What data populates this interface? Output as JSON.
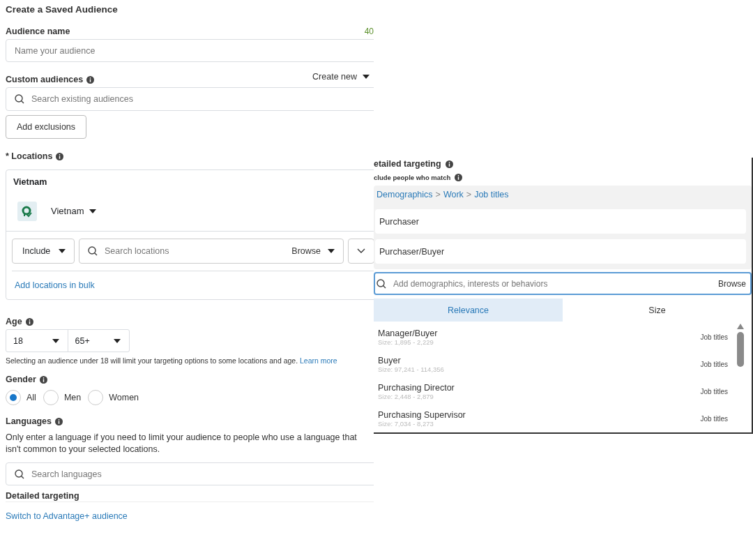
{
  "title": "Create a Saved Audience",
  "audience_name": {
    "label": "Audience name",
    "counter": "40",
    "placeholder": "Name your audience"
  },
  "custom_audiences": {
    "label": "Custom audiences",
    "create_new": "Create new",
    "placeholder": "Search existing audiences",
    "exclusions_button": "Add exclusions"
  },
  "locations": {
    "label": "Locations",
    "required_mark": "*",
    "group_title": "Vietnam",
    "country": "Vietnam",
    "include": "Include",
    "placeholder": "Search locations",
    "browse": "Browse",
    "bulk_link": "Add locations in bulk"
  },
  "age": {
    "label": "Age",
    "min": "18",
    "max": "65+",
    "note": "Selecting an audience under 18 will limit your targeting options to some locations and age.",
    "note_link": "Learn more"
  },
  "gender": {
    "label": "Gender",
    "options": [
      {
        "label": "All",
        "selected": true
      },
      {
        "label": "Men",
        "selected": false
      },
      {
        "label": "Women",
        "selected": false
      }
    ]
  },
  "languages": {
    "label": "Languages",
    "description": "Only enter a language if you need to limit your audience to people who use a language that isn't common to your selected locations.",
    "placeholder": "Search languages"
  },
  "detailed_targeting_cut": "Detailed targeting",
  "switch_link": "Switch to Advantage+ audience",
  "detailed_panel": {
    "heading": "etailed targeting",
    "subheading": "clude people who match",
    "breadcrumb": [
      "Demographics",
      "Work",
      "Job titles"
    ],
    "breadcrumb_separator": ">",
    "selected_items": [
      "Purchaser",
      "Purchaser/Buyer"
    ],
    "search_placeholder": "Add demographics, interests or behaviors",
    "browse": "Browse",
    "tabs": [
      {
        "label": "Relevance",
        "selected": true
      },
      {
        "label": "Size",
        "selected": false
      }
    ],
    "results": [
      {
        "name": "Manager/Buyer",
        "size": "Size: 1,895 - 2,229",
        "category": "Job titles"
      },
      {
        "name": "Buyer",
        "size": "Size: 97,241 - 114,356",
        "category": "Job titles"
      },
      {
        "name": "Purchasing Director",
        "size": "Size: 2,448 - 2,879",
        "category": "Job titles"
      },
      {
        "name": "Purchasing Supervisor",
        "size": "Size: 7,034 - 8,273",
        "category": "Job titles"
      }
    ]
  }
}
